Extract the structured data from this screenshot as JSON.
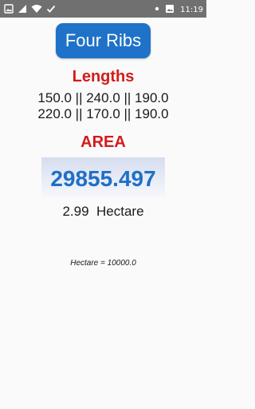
{
  "status_bar": {
    "time": "11:19",
    "left_icons": [
      "image-icon",
      "signal-icon",
      "wifi-icon",
      "check-icon"
    ],
    "right_icons": [
      "dot-icon",
      "image-icon"
    ]
  },
  "header": {
    "title_button_label": "Four Ribs"
  },
  "lengths": {
    "heading": "Lengths",
    "line1": "150.0 || 240.0 || 190.0",
    "line2": "220.0 || 170.0 || 190.0"
  },
  "area": {
    "heading": "AREA",
    "value": "29855.497",
    "hectare_value": "2.99",
    "hectare_unit": "Hectare"
  },
  "note": "Hectare = 10000.0",
  "colors": {
    "status_bar": "#707070",
    "button": "#1f72c8",
    "heading_red": "#d41b1b",
    "area_blue": "#1f6fc6"
  }
}
